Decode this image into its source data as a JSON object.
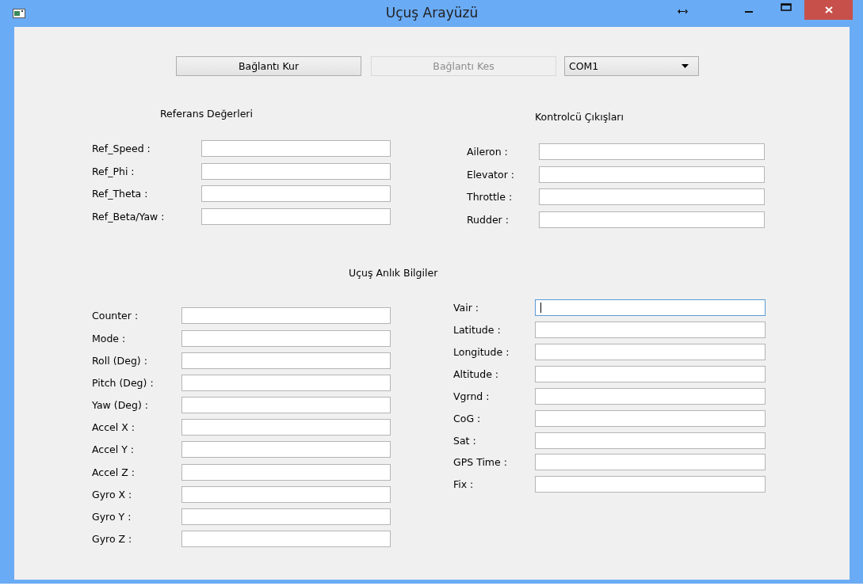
{
  "window": {
    "title": "Uçuş Arayüzü"
  },
  "toolbar": {
    "buttons": [
      {
        "label": "Bağlantı Kur",
        "disabled": false
      },
      {
        "label": "Bağlantı Kes",
        "disabled": true
      }
    ],
    "port": {
      "value": "COM1"
    }
  },
  "reference": {
    "title": "Referans Değerleri",
    "fields": [
      {
        "label": "Ref_Speed :",
        "focused": false
      },
      {
        "label": "Ref_Phi :",
        "focused": false
      },
      {
        "label": "Ref_Theta :",
        "focused": false
      },
      {
        "label": "Ref_Beta/Yaw :",
        "focused": false
      }
    ]
  },
  "controller": {
    "title": "Kontrolcü Çıkışları",
    "fields": [
      {
        "label": "Aileron :",
        "focused": false
      },
      {
        "label": "Elevator :",
        "focused": false
      },
      {
        "label": "Throttle :",
        "focused": false
      },
      {
        "label": "Rudder :",
        "focused": false
      }
    ]
  },
  "flight": {
    "title": "Uçuş Anlık Bilgiler",
    "left": [
      {
        "label": "Counter :",
        "focused": false
      },
      {
        "label": "Mode :",
        "focused": false
      },
      {
        "label": "Roll (Deg) :",
        "focused": false
      },
      {
        "label": "Pitch (Deg) :",
        "focused": false
      },
      {
        "label": "Yaw (Deg) :",
        "focused": false
      },
      {
        "label": "Accel X :",
        "focused": false
      },
      {
        "label": "Accel Y :",
        "focused": false
      },
      {
        "label": "Accel Z :",
        "focused": false
      },
      {
        "label": "Gyro X :",
        "focused": false
      },
      {
        "label": "Gyro Y :",
        "focused": false
      },
      {
        "label": "Gyro Z :",
        "focused": false
      }
    ],
    "right": [
      {
        "label": "Vair :",
        "focused": true
      },
      {
        "label": "Latitude :",
        "focused": false
      },
      {
        "label": "Longitude :",
        "focused": false
      },
      {
        "label": "Altitude :",
        "focused": false
      },
      {
        "label": "Vgrnd :",
        "focused": false
      },
      {
        "label": "CoG :",
        "focused": false
      },
      {
        "label": "Sat :",
        "focused": false
      },
      {
        "label": "GPS Time :",
        "focused": false
      },
      {
        "label": "Fix :",
        "focused": false
      }
    ]
  }
}
